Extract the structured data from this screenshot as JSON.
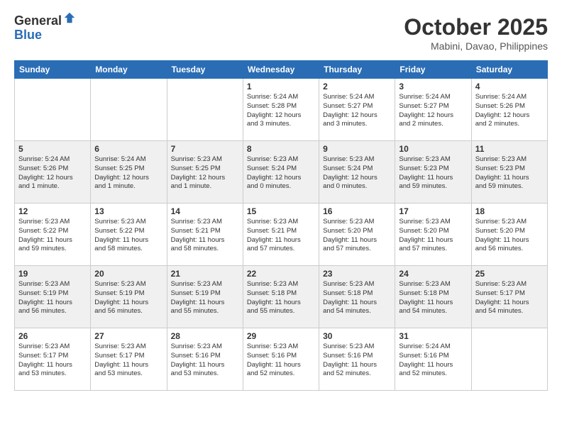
{
  "header": {
    "logo_general": "General",
    "logo_blue": "Blue",
    "month": "October 2025",
    "location": "Mabini, Davao, Philippines"
  },
  "weekdays": [
    "Sunday",
    "Monday",
    "Tuesday",
    "Wednesday",
    "Thursday",
    "Friday",
    "Saturday"
  ],
  "weeks": [
    {
      "shaded": false,
      "days": [
        {
          "num": "",
          "info": ""
        },
        {
          "num": "",
          "info": ""
        },
        {
          "num": "",
          "info": ""
        },
        {
          "num": "1",
          "info": "Sunrise: 5:24 AM\nSunset: 5:28 PM\nDaylight: 12 hours\nand 3 minutes."
        },
        {
          "num": "2",
          "info": "Sunrise: 5:24 AM\nSunset: 5:27 PM\nDaylight: 12 hours\nand 3 minutes."
        },
        {
          "num": "3",
          "info": "Sunrise: 5:24 AM\nSunset: 5:27 PM\nDaylight: 12 hours\nand 2 minutes."
        },
        {
          "num": "4",
          "info": "Sunrise: 5:24 AM\nSunset: 5:26 PM\nDaylight: 12 hours\nand 2 minutes."
        }
      ]
    },
    {
      "shaded": true,
      "days": [
        {
          "num": "5",
          "info": "Sunrise: 5:24 AM\nSunset: 5:26 PM\nDaylight: 12 hours\nand 1 minute."
        },
        {
          "num": "6",
          "info": "Sunrise: 5:24 AM\nSunset: 5:25 PM\nDaylight: 12 hours\nand 1 minute."
        },
        {
          "num": "7",
          "info": "Sunrise: 5:23 AM\nSunset: 5:25 PM\nDaylight: 12 hours\nand 1 minute."
        },
        {
          "num": "8",
          "info": "Sunrise: 5:23 AM\nSunset: 5:24 PM\nDaylight: 12 hours\nand 0 minutes."
        },
        {
          "num": "9",
          "info": "Sunrise: 5:23 AM\nSunset: 5:24 PM\nDaylight: 12 hours\nand 0 minutes."
        },
        {
          "num": "10",
          "info": "Sunrise: 5:23 AM\nSunset: 5:23 PM\nDaylight: 11 hours\nand 59 minutes."
        },
        {
          "num": "11",
          "info": "Sunrise: 5:23 AM\nSunset: 5:23 PM\nDaylight: 11 hours\nand 59 minutes."
        }
      ]
    },
    {
      "shaded": false,
      "days": [
        {
          "num": "12",
          "info": "Sunrise: 5:23 AM\nSunset: 5:22 PM\nDaylight: 11 hours\nand 59 minutes."
        },
        {
          "num": "13",
          "info": "Sunrise: 5:23 AM\nSunset: 5:22 PM\nDaylight: 11 hours\nand 58 minutes."
        },
        {
          "num": "14",
          "info": "Sunrise: 5:23 AM\nSunset: 5:21 PM\nDaylight: 11 hours\nand 58 minutes."
        },
        {
          "num": "15",
          "info": "Sunrise: 5:23 AM\nSunset: 5:21 PM\nDaylight: 11 hours\nand 57 minutes."
        },
        {
          "num": "16",
          "info": "Sunrise: 5:23 AM\nSunset: 5:20 PM\nDaylight: 11 hours\nand 57 minutes."
        },
        {
          "num": "17",
          "info": "Sunrise: 5:23 AM\nSunset: 5:20 PM\nDaylight: 11 hours\nand 57 minutes."
        },
        {
          "num": "18",
          "info": "Sunrise: 5:23 AM\nSunset: 5:20 PM\nDaylight: 11 hours\nand 56 minutes."
        }
      ]
    },
    {
      "shaded": true,
      "days": [
        {
          "num": "19",
          "info": "Sunrise: 5:23 AM\nSunset: 5:19 PM\nDaylight: 11 hours\nand 56 minutes."
        },
        {
          "num": "20",
          "info": "Sunrise: 5:23 AM\nSunset: 5:19 PM\nDaylight: 11 hours\nand 56 minutes."
        },
        {
          "num": "21",
          "info": "Sunrise: 5:23 AM\nSunset: 5:19 PM\nDaylight: 11 hours\nand 55 minutes."
        },
        {
          "num": "22",
          "info": "Sunrise: 5:23 AM\nSunset: 5:18 PM\nDaylight: 11 hours\nand 55 minutes."
        },
        {
          "num": "23",
          "info": "Sunrise: 5:23 AM\nSunset: 5:18 PM\nDaylight: 11 hours\nand 54 minutes."
        },
        {
          "num": "24",
          "info": "Sunrise: 5:23 AM\nSunset: 5:18 PM\nDaylight: 11 hours\nand 54 minutes."
        },
        {
          "num": "25",
          "info": "Sunrise: 5:23 AM\nSunset: 5:17 PM\nDaylight: 11 hours\nand 54 minutes."
        }
      ]
    },
    {
      "shaded": false,
      "days": [
        {
          "num": "26",
          "info": "Sunrise: 5:23 AM\nSunset: 5:17 PM\nDaylight: 11 hours\nand 53 minutes."
        },
        {
          "num": "27",
          "info": "Sunrise: 5:23 AM\nSunset: 5:17 PM\nDaylight: 11 hours\nand 53 minutes."
        },
        {
          "num": "28",
          "info": "Sunrise: 5:23 AM\nSunset: 5:16 PM\nDaylight: 11 hours\nand 53 minutes."
        },
        {
          "num": "29",
          "info": "Sunrise: 5:23 AM\nSunset: 5:16 PM\nDaylight: 11 hours\nand 52 minutes."
        },
        {
          "num": "30",
          "info": "Sunrise: 5:23 AM\nSunset: 5:16 PM\nDaylight: 11 hours\nand 52 minutes."
        },
        {
          "num": "31",
          "info": "Sunrise: 5:24 AM\nSunset: 5:16 PM\nDaylight: 11 hours\nand 52 minutes."
        },
        {
          "num": "",
          "info": ""
        }
      ]
    }
  ]
}
